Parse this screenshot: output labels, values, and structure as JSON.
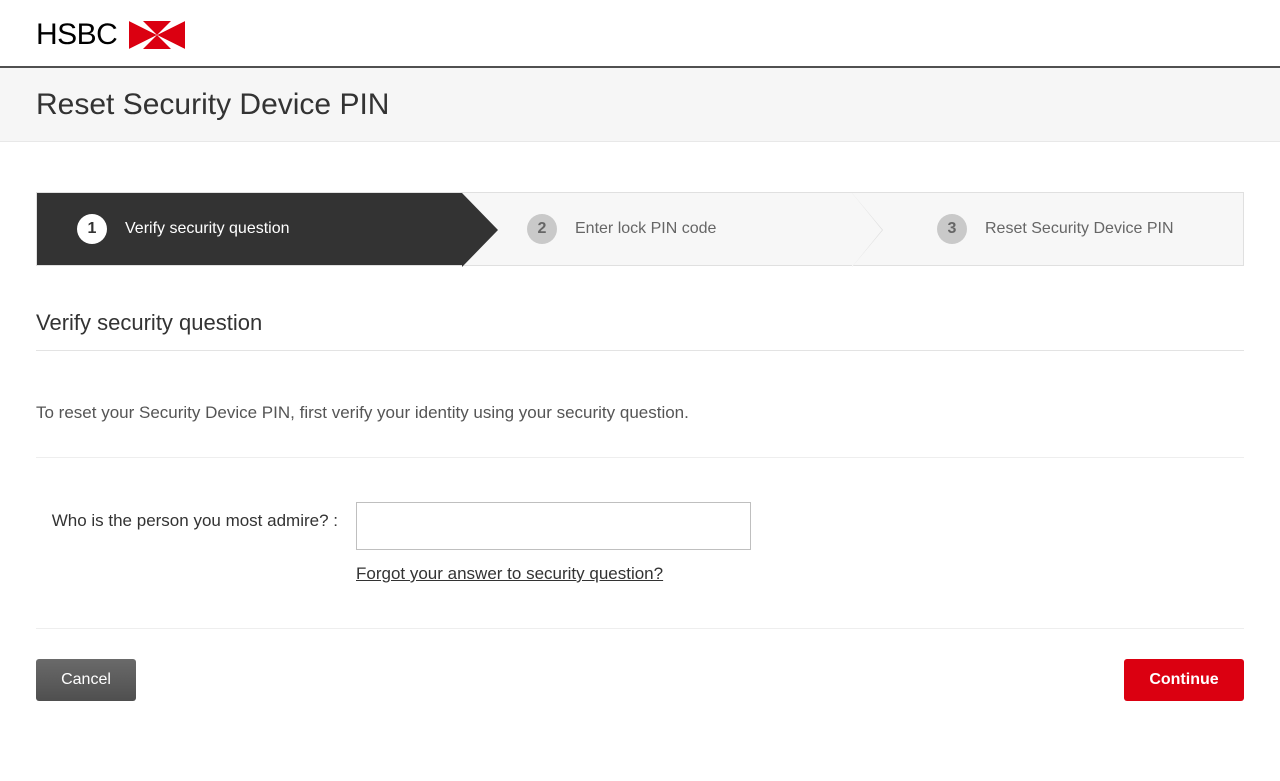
{
  "brand": {
    "name": "HSBC"
  },
  "page": {
    "title": "Reset Security Device PIN"
  },
  "stepper": {
    "steps": [
      {
        "num": "1",
        "label": "Verify security question"
      },
      {
        "num": "2",
        "label": "Enter lock PIN code"
      },
      {
        "num": "3",
        "label": "Reset Security Device PIN"
      }
    ]
  },
  "section": {
    "heading": "Verify security question",
    "instruction": "To reset your Security Device PIN, first verify your identity using your security question."
  },
  "form": {
    "question_label": "Who is the person you most admire? :",
    "answer_value": "",
    "forgot_link": "Forgot your answer to security question?"
  },
  "buttons": {
    "cancel": "Cancel",
    "continue": "Continue"
  }
}
